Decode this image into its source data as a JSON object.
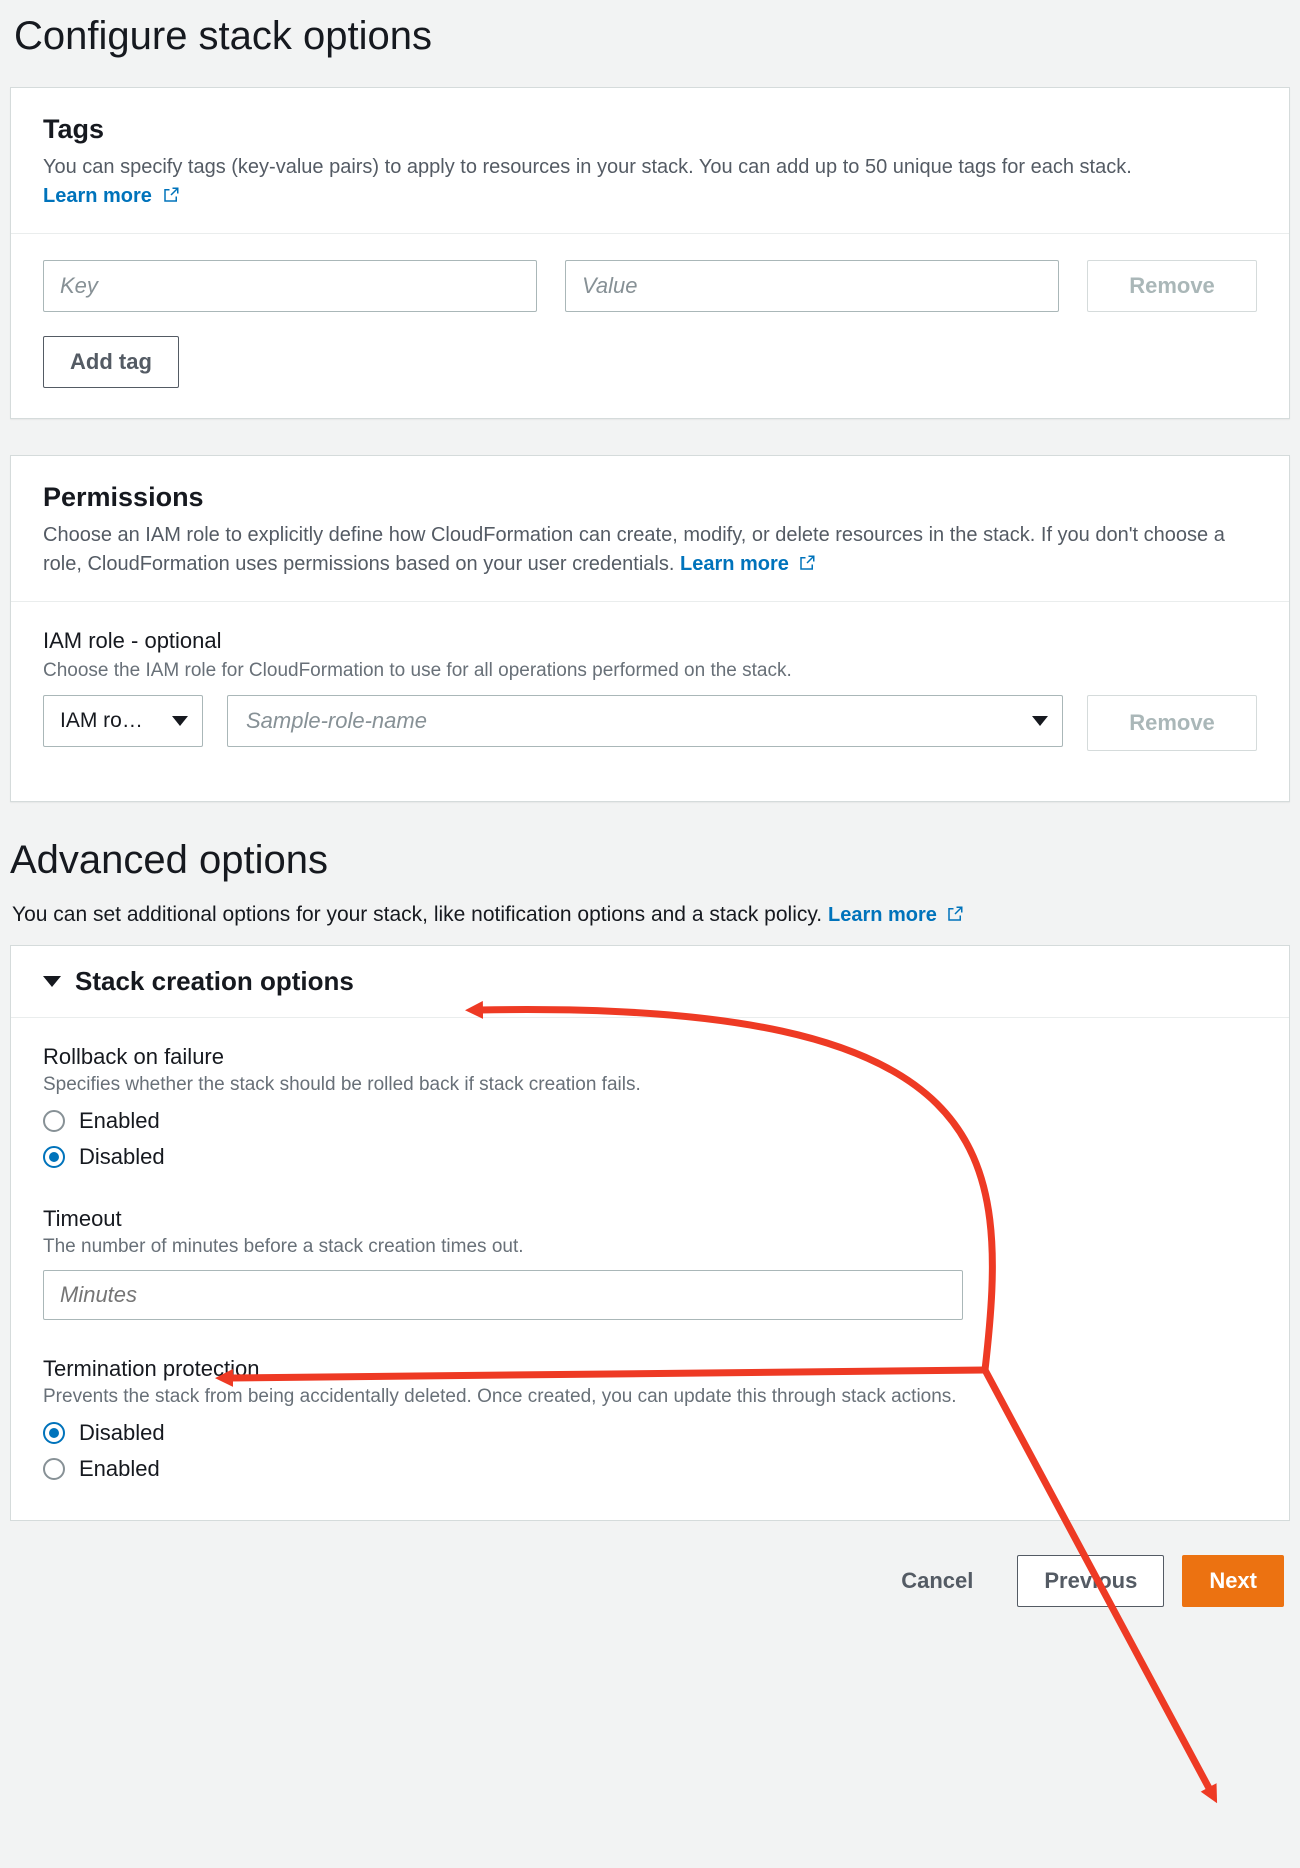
{
  "page_title": "Configure stack options",
  "tags_panel": {
    "title": "Tags",
    "desc": "You can specify tags (key-value pairs) to apply to resources in your stack. You can add up to 50 unique tags for each stack.  ",
    "learn_more": "Learn more",
    "key_placeholder": "Key",
    "value_placeholder": "Value",
    "remove_label": "Remove",
    "add_tag_label": "Add tag"
  },
  "permissions_panel": {
    "title": "Permissions",
    "desc": "Choose an IAM role to explicitly define how CloudFormation can create, modify, or delete resources in the stack. If you don't choose a role, CloudFormation uses permissions based on your user credentials.  ",
    "learn_more": "Learn more",
    "field_label": "IAM role - optional",
    "field_hint": "Choose the IAM role for CloudFormation to use for all operations performed on the stack.",
    "type_selected": "IAM ro…",
    "role_placeholder": "Sample-role-name",
    "remove_label": "Remove"
  },
  "advanced": {
    "title": "Advanced options",
    "desc_prefix": "You can set additional options for your stack, like notification options and a stack policy. ",
    "learn_more": "Learn more",
    "stack_creation_title": "Stack creation options",
    "rollback": {
      "label": "Rollback on failure",
      "hint": "Specifies whether the stack should be rolled back if stack creation fails.",
      "enabled": "Enabled",
      "disabled": "Disabled",
      "selected": "Disabled"
    },
    "timeout": {
      "label": "Timeout",
      "hint": "The number of minutes before a stack creation times out.",
      "placeholder": "Minutes"
    },
    "termination": {
      "label": "Termination protection",
      "hint": "Prevents the stack from being accidentally deleted. Once created, you can update this through stack actions.",
      "disabled": "Disabled",
      "enabled": "Enabled",
      "selected": "Disabled"
    }
  },
  "footer": {
    "cancel": "Cancel",
    "previous": "Previous",
    "next": "Next"
  }
}
